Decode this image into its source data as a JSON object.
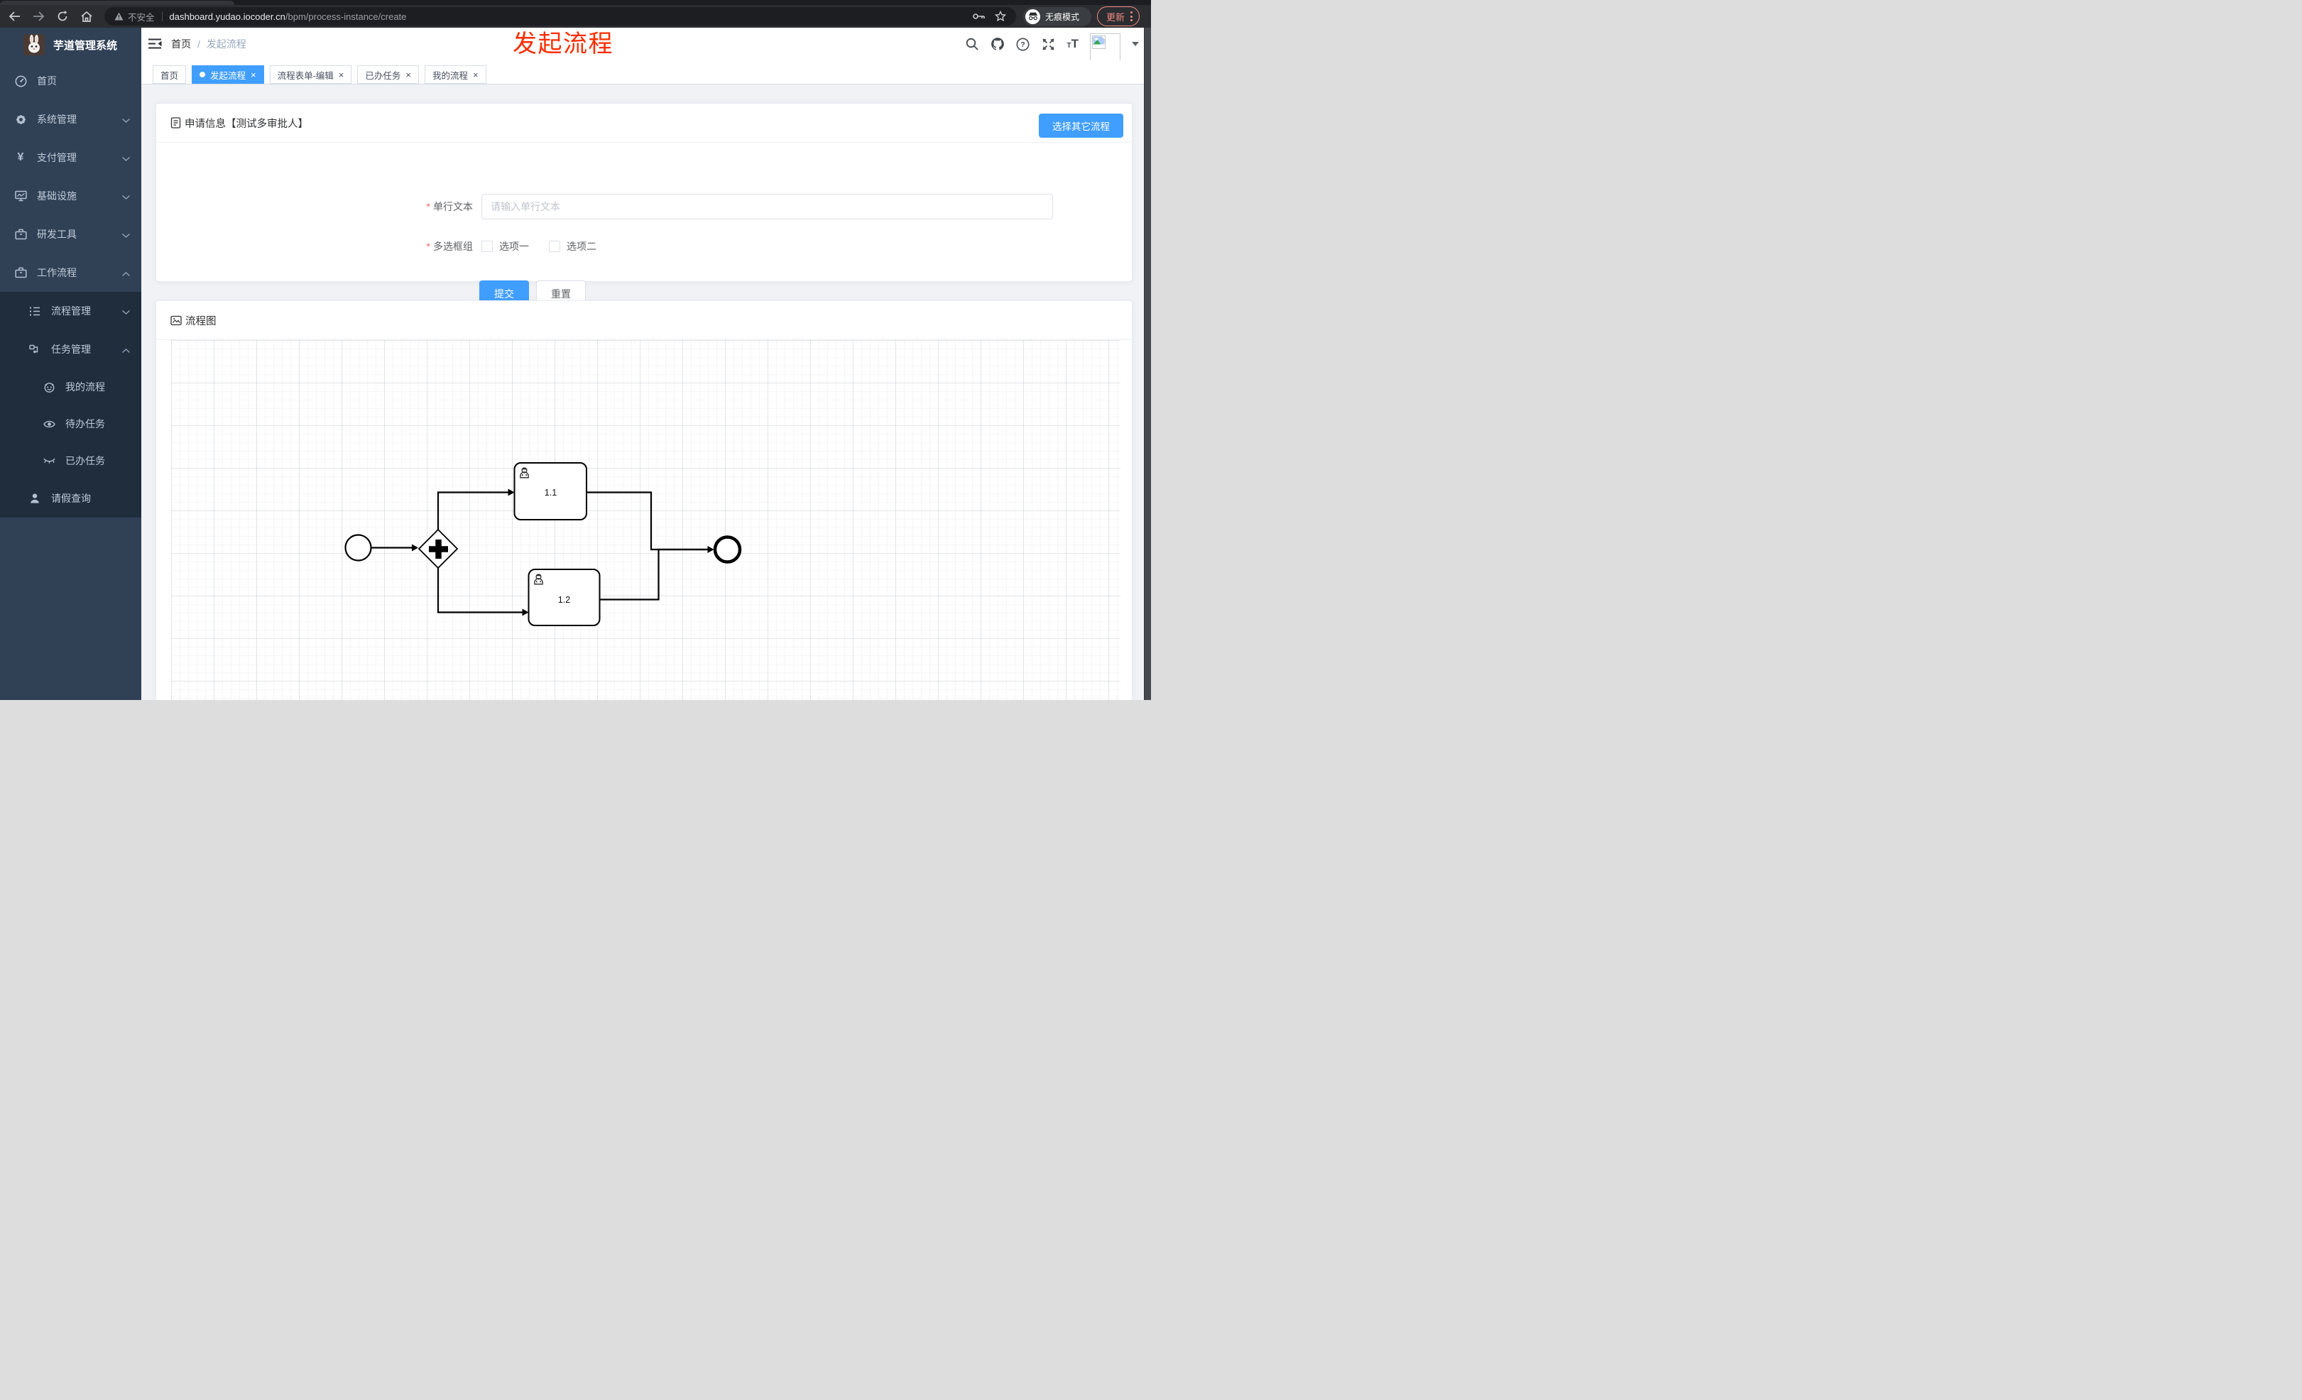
{
  "browser": {
    "security_label": "不安全",
    "url_domain": "dashboard.yudao.iocoder.cn",
    "url_path": "/bpm/process-instance/create",
    "incognito_label": "无痕模式",
    "update_label": "更新"
  },
  "annotation": {
    "text": "发起流程",
    "color": "#ff2d00"
  },
  "sidebar": {
    "title": "芋道管理系统",
    "items": [
      {
        "label": "首页",
        "icon": "dashboard-icon",
        "level": 1
      },
      {
        "label": "系统管理",
        "icon": "gear-icon",
        "level": 1,
        "chevron": "down"
      },
      {
        "label": "支付管理",
        "icon": "yen-icon",
        "level": 1,
        "chevron": "down"
      },
      {
        "label": "基础设施",
        "icon": "monitor-icon",
        "level": 1,
        "chevron": "down"
      },
      {
        "label": "研发工具",
        "icon": "toolbox-icon",
        "level": 1,
        "chevron": "down"
      },
      {
        "label": "工作流程",
        "icon": "toolbox-icon",
        "level": 1,
        "chevron": "up",
        "expanded": true
      },
      {
        "label": "流程管理",
        "icon": "list-tree-icon",
        "level": 2,
        "chevron": "down"
      },
      {
        "label": "任务管理",
        "icon": "route-icon",
        "level": 2,
        "chevron": "up",
        "expanded": true
      },
      {
        "label": "我的流程",
        "icon": "face-icon",
        "level": 3
      },
      {
        "label": "待办任务",
        "icon": "eye-icon",
        "level": 3
      },
      {
        "label": "已办任务",
        "icon": "eye-closed-icon",
        "level": 3
      },
      {
        "label": "请假查询",
        "icon": "user-icon",
        "level": 2
      }
    ]
  },
  "header": {
    "breadcrumb": {
      "home": "首页",
      "separator": "/",
      "current": "发起流程"
    },
    "icons": [
      "search-icon",
      "github-icon",
      "help-icon",
      "fullscreen-icon",
      "font-size-icon",
      "avatar",
      "caret-down-icon"
    ]
  },
  "tabs": {
    "close_glyph": "×",
    "items": [
      {
        "label": "首页",
        "active": false,
        "closable": false
      },
      {
        "label": "发起流程",
        "active": true,
        "closable": true
      },
      {
        "label": "流程表单-编辑",
        "active": false,
        "closable": true
      },
      {
        "label": "已办任务",
        "active": false,
        "closable": true
      },
      {
        "label": "我的流程",
        "active": false,
        "closable": true
      }
    ]
  },
  "form_card": {
    "title": "申请信息【测试多审批人】",
    "select_other_button": "选择其它流程",
    "required_mark": "*",
    "text_field": {
      "label": "单行文本",
      "placeholder": "请输入单行文本",
      "value": ""
    },
    "checkbox_field": {
      "label": "多选框组",
      "options": [
        {
          "label": "选项一",
          "checked": false
        },
        {
          "label": "选项二",
          "checked": false
        }
      ]
    },
    "submit_button": "提交",
    "reset_button": "重置"
  },
  "flow_card": {
    "title": "流程图",
    "diagram": {
      "type": "bpmn",
      "nodes": [
        {
          "id": "start",
          "type": "start-event"
        },
        {
          "id": "gateway",
          "type": "parallel-gateway"
        },
        {
          "id": "task1",
          "type": "user-task",
          "label": "1.1"
        },
        {
          "id": "task2",
          "type": "user-task",
          "label": "1.2"
        },
        {
          "id": "end",
          "type": "end-event"
        }
      ],
      "edges": [
        "start->gateway",
        "gateway->task1",
        "gateway->task2",
        "task1->end",
        "task2->end"
      ]
    }
  },
  "colors": {
    "primary": "#409eff",
    "sidebar_bg": "#304156",
    "submenu_bg": "#1f2d3d",
    "update_accent": "#f28b82",
    "annotation_red": "#ff2d00"
  }
}
